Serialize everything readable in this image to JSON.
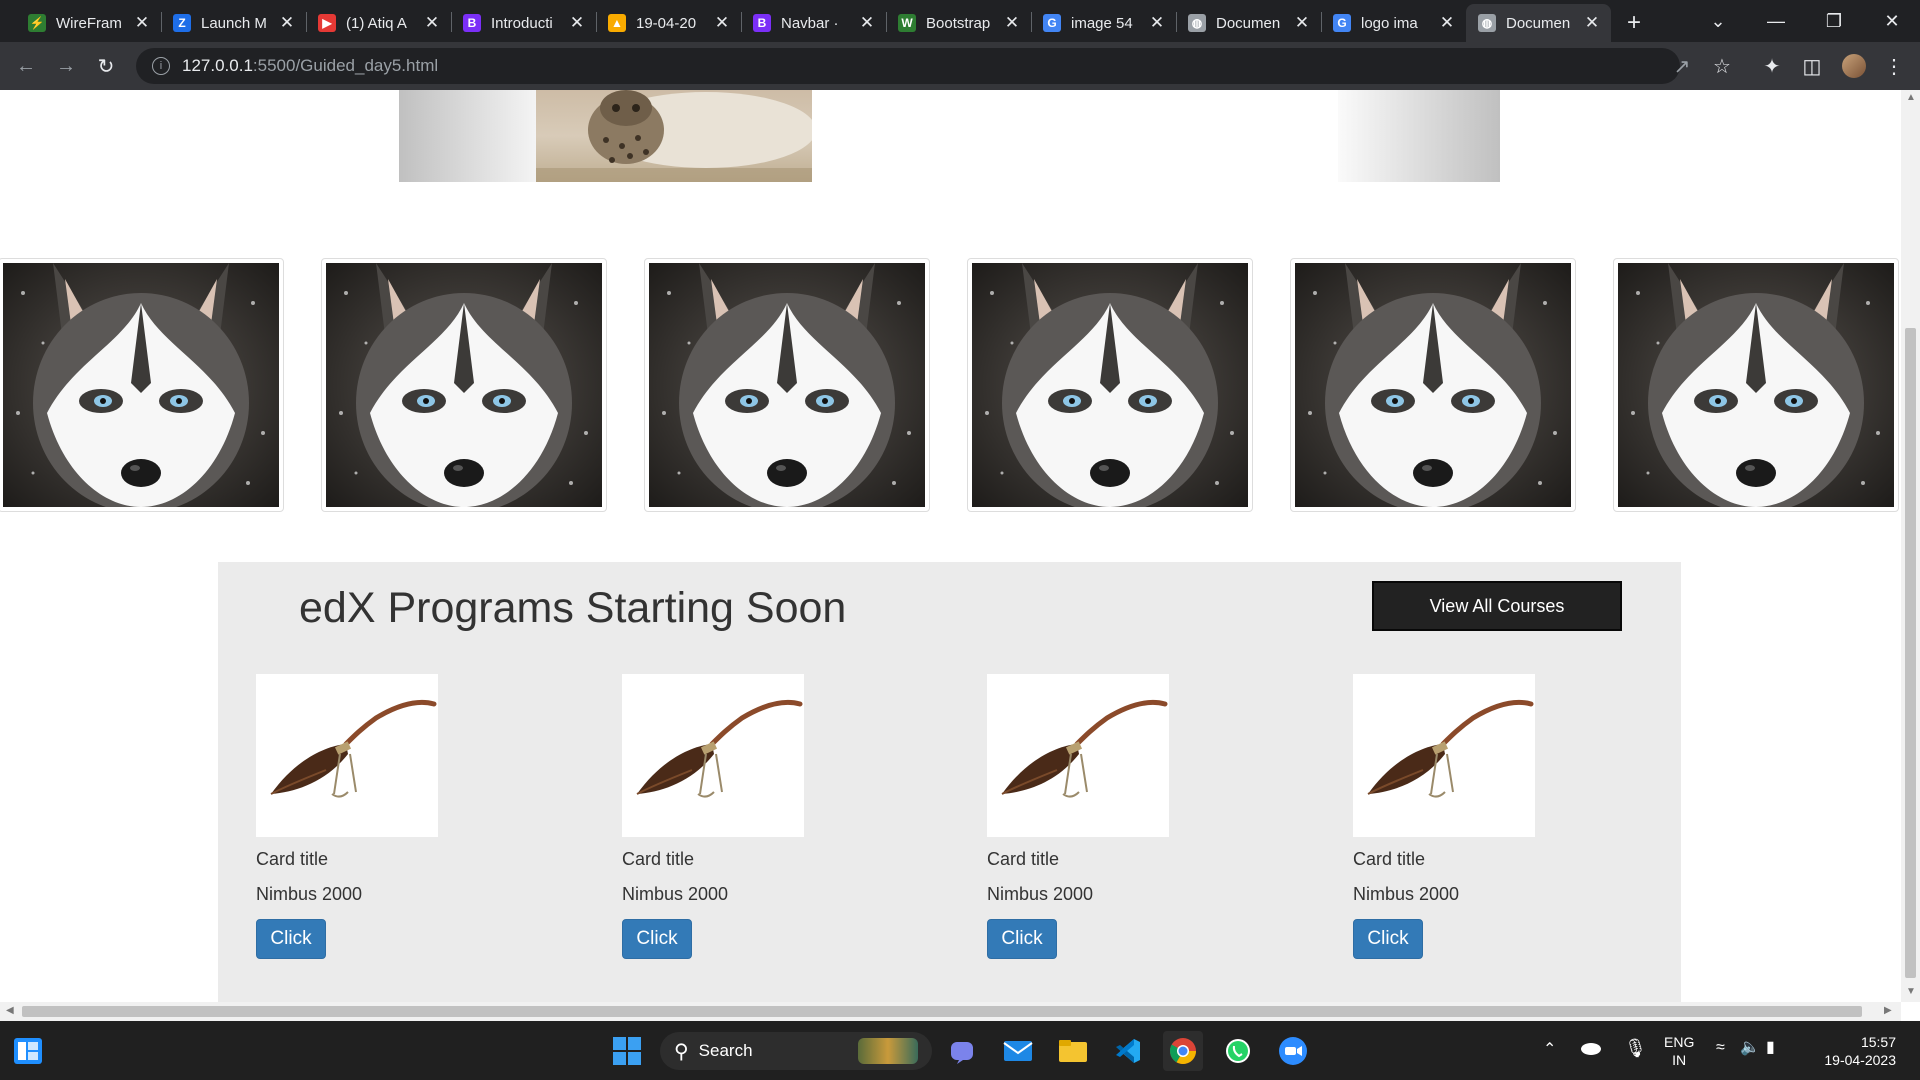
{
  "browser": {
    "tabs": [
      {
        "title": "WireFram",
        "favicon_color": "#2e7d32",
        "icon": "wireframe-icon",
        "glyph": "⚡"
      },
      {
        "title": "Launch M",
        "favicon_color": "#1e6ee8",
        "icon": "zoho-icon",
        "glyph": "Z"
      },
      {
        "title": "(1) Atiq A",
        "favicon_color": "#e53935",
        "icon": "youtube-icon",
        "glyph": "▶"
      },
      {
        "title": "Introducti",
        "favicon_color": "#7b2ff7",
        "icon": "bootstrap-icon",
        "glyph": "B"
      },
      {
        "title": "19-04-20",
        "favicon_color": "#f9ab00",
        "icon": "google-drive-icon",
        "glyph": "▲"
      },
      {
        "title": "Navbar · ",
        "favicon_color": "#7b2ff7",
        "icon": "bootstrap-icon",
        "glyph": "B"
      },
      {
        "title": "Bootstrap",
        "favicon_color": "#2e7d32",
        "icon": "w3schools-icon",
        "glyph": "W"
      },
      {
        "title": "image 54",
        "favicon_color": "#4285f4",
        "icon": "google-icon",
        "glyph": "G"
      },
      {
        "title": "Documen",
        "favicon_color": "#9aa0a6",
        "icon": "globe-icon",
        "glyph": "◍"
      },
      {
        "title": "logo ima",
        "favicon_color": "#4285f4",
        "icon": "google-icon",
        "glyph": "G"
      },
      {
        "title": "Documen",
        "favicon_color": "#9aa0a6",
        "icon": "globe-icon",
        "glyph": "◍"
      }
    ],
    "active_tab_index": 10,
    "new_tab": "+",
    "url_host": "127.0.0.1",
    "url_path": ":5500/Guided_day5.html"
  },
  "page": {
    "programs_title": "edX Programs Starting Soon",
    "view_all_label": "View All Courses",
    "courses": [
      {
        "title": "Card title",
        "text": "Nimbus 2000",
        "button": "Click"
      },
      {
        "title": "Card title",
        "text": "Nimbus 2000",
        "button": "Click"
      },
      {
        "title": "Card title",
        "text": "Nimbus 2000",
        "button": "Click"
      },
      {
        "title": "Card title",
        "text": "Nimbus 2000",
        "button": "Click"
      }
    ],
    "colors": {
      "button_primary": "#337ab7",
      "dark_button": "#222222",
      "section_bg": "#ebebeb"
    }
  },
  "taskbar": {
    "search_label": "Search",
    "lang_top": "ENG",
    "lang_bottom": "IN",
    "time": "15:57",
    "date": "19-04-2023"
  }
}
